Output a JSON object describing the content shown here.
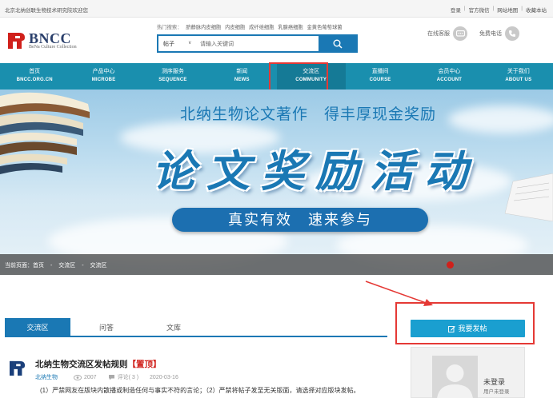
{
  "topbar": {
    "welcome": "北京北纳创联生物技术研究院欢迎您",
    "links": [
      "登录",
      "官方微信",
      "网站地图",
      "收藏本站"
    ]
  },
  "logo": {
    "name": "BNCC",
    "subtitle": "BeNa Culture Collection"
  },
  "search": {
    "hot_label": "热门搜索：",
    "hot_items": [
      "脐静脉内皮细胞",
      "内皮细胞",
      "成纤维细胞",
      "乳腺癌细胞",
      "金黄色葡萄球菌"
    ],
    "category": "帖子",
    "placeholder": "请输入关键词"
  },
  "service": {
    "online": "在线客服",
    "phone": "免费电话"
  },
  "nav": {
    "items": [
      {
        "zh": "首页",
        "en": "BNCC.ORG.CN"
      },
      {
        "zh": "产品中心",
        "en": "MICROBE"
      },
      {
        "zh": "测序服务",
        "en": "SEQUENCE"
      },
      {
        "zh": "新闻",
        "en": "NEWS"
      },
      {
        "zh": "交流区",
        "en": "COMMUNITY"
      },
      {
        "zh": "直播间",
        "en": "COURSE"
      },
      {
        "zh": "会员中心",
        "en": "ACCOUNT"
      },
      {
        "zh": "关于我们",
        "en": "ABOUT US"
      }
    ],
    "active_index": 4
  },
  "banner": {
    "subtitle": "北纳生物论文著作　得丰厚现金奖励",
    "title": "论文奖励活动",
    "slogan": "真实有效　速来参与"
  },
  "breadcrumb": {
    "items": [
      "当前页面：首页",
      "-",
      "交流区",
      "-",
      "交流区"
    ]
  },
  "tabs": [
    "交流区",
    "问答",
    "文库"
  ],
  "post_button": "我要发帖",
  "post": {
    "title": "北纳生物交流区发帖规则",
    "pin": "【置顶】",
    "category": "北纳生物",
    "views": "2007",
    "comments": "评论( 3 )",
    "date": "2020-03-16",
    "excerpt": "(1）严禁网友在版块内散播或制造任何与事实不符的言论；（2）严禁将帖子发至无关版面，请选择对应版块发帖。"
  },
  "user": {
    "status": "未登录",
    "hint": "用户未登录"
  },
  "colors": {
    "brand_blue": "#1a78b4",
    "nav_teal": "#1a8fae",
    "highlight_red": "#e53935",
    "pin_red": "#d0201b"
  }
}
